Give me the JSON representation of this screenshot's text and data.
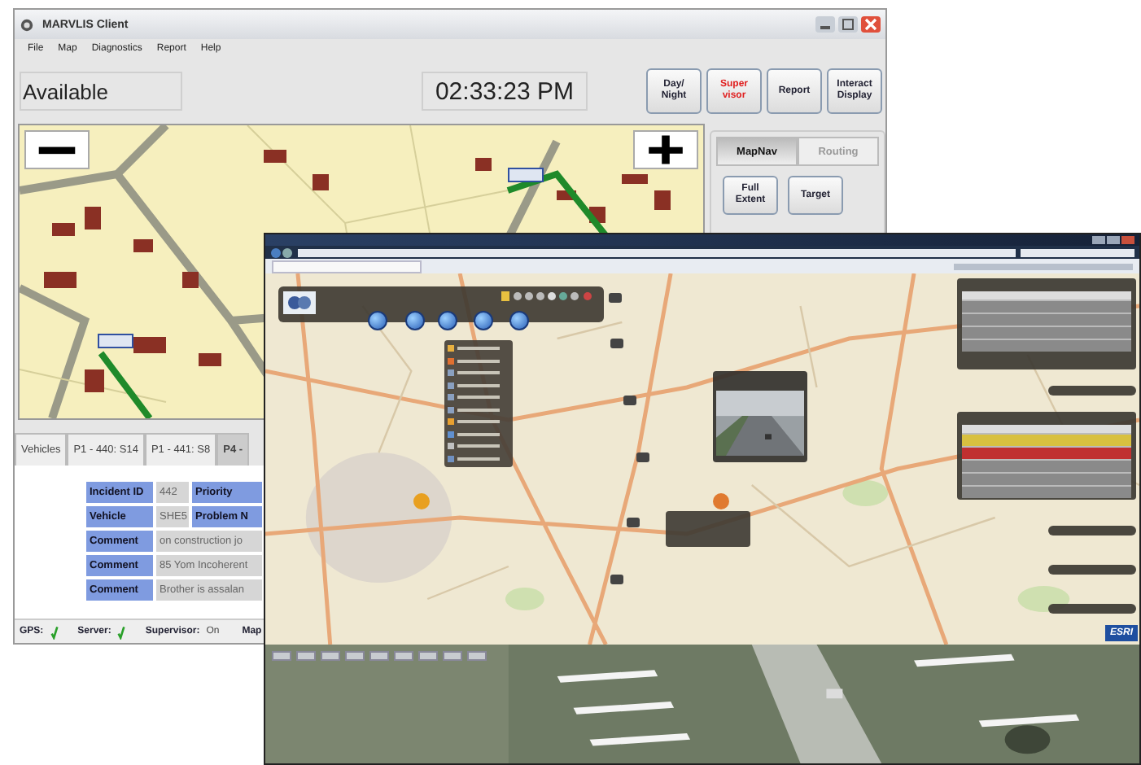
{
  "client_window": {
    "title": "MARVLIS Client"
  },
  "menu": [
    "File",
    "Map",
    "Diagnostics",
    "Report",
    "Help"
  ],
  "status": {
    "value": "Available"
  },
  "clock": {
    "value": "02:33:23 PM"
  },
  "toolbar_buttons": [
    {
      "lines": [
        "Day/",
        "Night"
      ],
      "kind": "normal"
    },
    {
      "lines": [
        "Super",
        "visor"
      ],
      "kind": "alert"
    },
    {
      "lines": [
        "Report"
      ],
      "kind": "normal"
    },
    {
      "lines": [
        "Interact",
        "Display"
      ],
      "kind": "normal"
    }
  ],
  "nav_tabs": [
    {
      "label": "MapNav",
      "selected": true
    },
    {
      "label": "Routing",
      "selected": false
    }
  ],
  "nav_buttons": [
    {
      "lines": [
        "Full",
        "Extent"
      ]
    },
    {
      "lines": [
        "Target"
      ]
    }
  ],
  "incident_tabs": [
    {
      "label": "Vehicles",
      "selected": false
    },
    {
      "label": "P1 - 440: S14",
      "selected": false
    },
    {
      "label": "P1 - 441: S8",
      "selected": false
    },
    {
      "label": "P4 -",
      "selected": true
    }
  ],
  "incident_table": {
    "rows": [
      {
        "cells": [
          {
            "text": "Incident ID",
            "kind": "label"
          },
          {
            "text": "442",
            "kind": "value"
          },
          {
            "text": "Priority",
            "kind": "label"
          }
        ]
      },
      {
        "cells": [
          {
            "text": "Vehicle",
            "kind": "label"
          },
          {
            "text": "SHE5",
            "kind": "value"
          },
          {
            "text": "Problem N",
            "kind": "label"
          }
        ]
      },
      {
        "cells": [
          {
            "text": "Comment",
            "kind": "label"
          },
          {
            "text": "on construction jo",
            "kind": "value"
          }
        ]
      },
      {
        "cells": [
          {
            "text": "Comment",
            "kind": "label"
          },
          {
            "text": "85 Yom Incoherent",
            "kind": "value"
          }
        ]
      },
      {
        "cells": [
          {
            "text": "Comment",
            "kind": "label"
          },
          {
            "text": "Brother is assalan",
            "kind": "value"
          }
        ]
      }
    ]
  },
  "status_bar": [
    {
      "kind": "check",
      "label": "GPS:"
    },
    {
      "kind": "check",
      "label": "Server:"
    },
    {
      "kind": "text",
      "label": "Supervisor:",
      "value": "On"
    },
    {
      "kind": "plain",
      "label": "Map"
    }
  ],
  "browser": {
    "logo": "ESRI"
  }
}
